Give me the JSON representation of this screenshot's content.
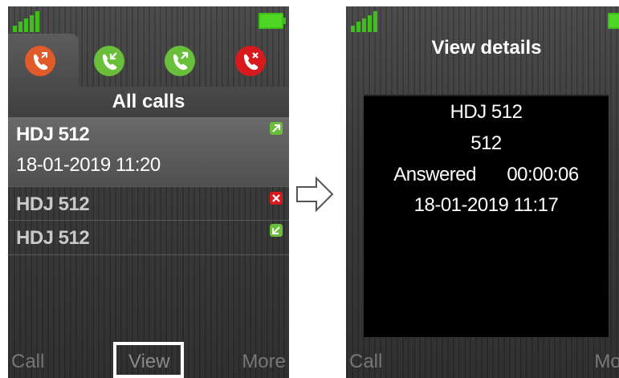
{
  "left_screen": {
    "title": "All calls",
    "tabs": [
      {
        "icon": "all-calls-icon",
        "color": "#e05a2a"
      },
      {
        "icon": "incoming-call-icon",
        "color": "#6abf3a"
      },
      {
        "icon": "outgoing-call-icon",
        "color": "#6abf3a"
      },
      {
        "icon": "missed-call-icon",
        "color": "#d8191e"
      }
    ],
    "calls": [
      {
        "name": "HDJ 512",
        "date": "18-01-2019 11:20",
        "status": "outgoing-call-icon"
      },
      {
        "name": "HDJ 512",
        "status": "missed-call-icon"
      },
      {
        "name": "HDJ 512",
        "status": "incoming-call-icon"
      }
    ],
    "softkeys": {
      "left": "Call",
      "center": "View",
      "right": "More"
    }
  },
  "right_screen": {
    "title": "View details",
    "details": {
      "name": "HDJ 512",
      "number": "512",
      "status": "Answered",
      "duration": "00:00:06",
      "datetime": "18-01-2019 11:17"
    },
    "softkeys": {
      "left": "Call",
      "right": "More"
    }
  },
  "colors": {
    "signal": "#3fbf1a",
    "battery": "#3fbf1a",
    "accent_green": "#6abf3a",
    "accent_red": "#d8191e",
    "accent_orange": "#e05a2a"
  }
}
